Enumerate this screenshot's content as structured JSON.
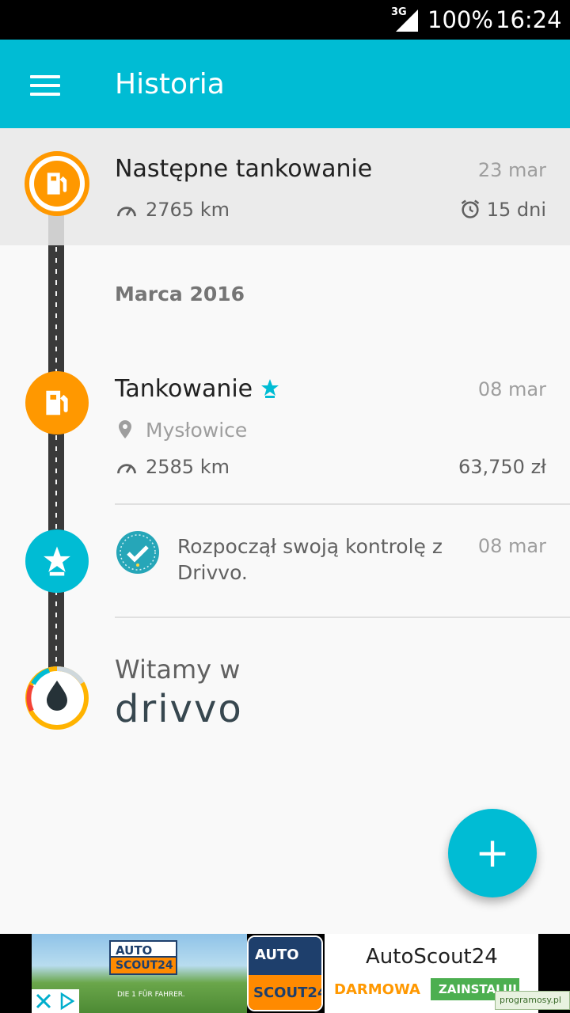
{
  "status_bar": {
    "network": "3G",
    "battery": "100%",
    "time": "16:24"
  },
  "app_bar": {
    "title": "Historia",
    "menu_icon": "hamburger-menu-icon"
  },
  "next_refuel": {
    "title": "Następne tankowanie",
    "date": "23 mar",
    "distance": "2765 km",
    "days": "15 dni",
    "color": "#ff9800"
  },
  "month_header": "Marca 2016",
  "entries": [
    {
      "title": "Tankowanie",
      "date": "08 mar",
      "location": "Mysłowice",
      "odometer": "2585 km",
      "cost": "63,750 zł",
      "color": "#ff9800"
    },
    {
      "text": "Rozpoczął swoją kontrolę z Drivvo.",
      "date": "08 mar",
      "color": "#00bcd4"
    }
  ],
  "welcome": {
    "text": "Witamy w",
    "brand": "drivvo"
  },
  "fab": {
    "label": "+"
  },
  "ad": {
    "logo_top": "AUTO",
    "logo_bottom": "SCOUT24",
    "tagline": "DIE 1 FÜR FAHRER.",
    "app_name": "AutoScout24",
    "free_label": "DARMOWA",
    "install_label": "ZAINSTALUJ"
  },
  "watermark": "programosy.pl",
  "accent_color": "#00bcd4"
}
